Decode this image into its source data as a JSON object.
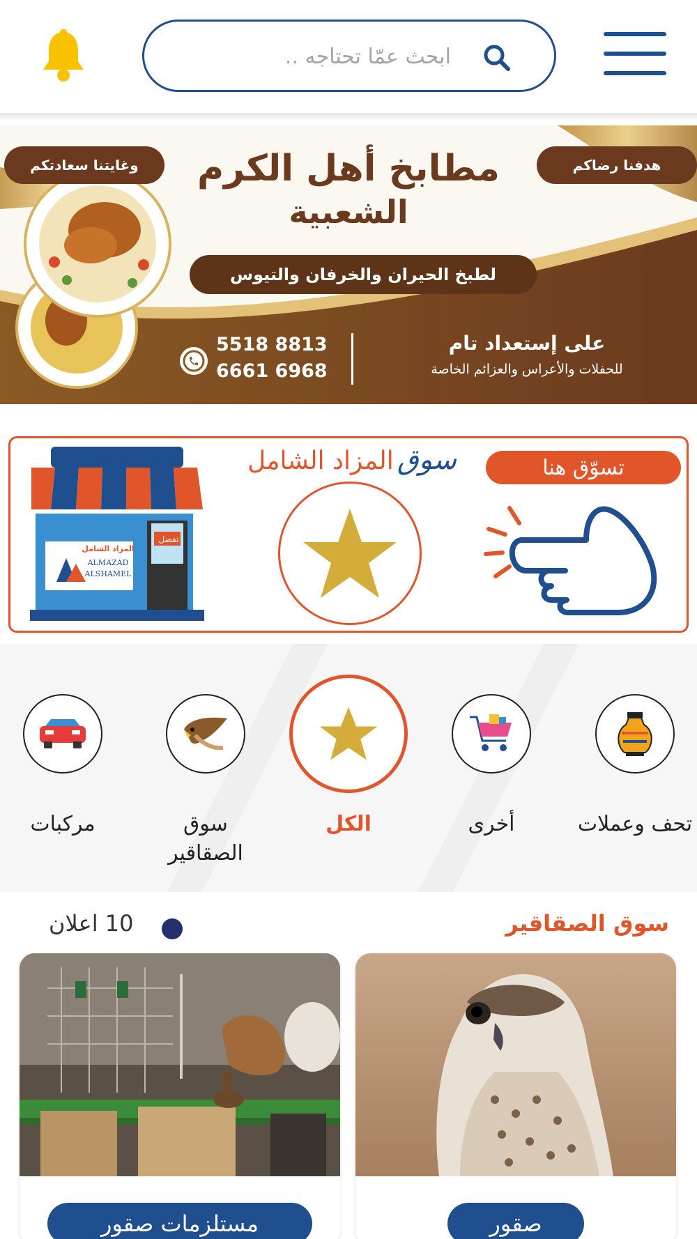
{
  "header": {
    "search_placeholder": "ابحث عمّا تحتاجه ..",
    "search_icon": "search-icon",
    "menu_icon": "hamburger-menu-icon",
    "bell_icon": "bell-icon"
  },
  "banner": {
    "tag_right": "هدفنا رضاكم",
    "tag_left": "وغايتنا سعادتكم",
    "title_line1": "مطابخ أهل الكرم",
    "title_line2": "الشعبية",
    "subtitle": "لطبخ الحيران والخرفان والتيوس",
    "ready_line1": "على إستعداد تام",
    "ready_line2": "للحفلات والأعراس والعزائم الخاصة",
    "phone1": "5518 8813",
    "phone2": "6661 6968"
  },
  "promo": {
    "title_blue": "سوق",
    "title_orange": "المزاد الشامل",
    "shop_here": "تسوّق هنا",
    "shop_sign": "تفضل",
    "shop_logo_ar": "المزاد الشامل",
    "shop_logo_en1": "ALMAZAD",
    "shop_logo_en2": "ALSHAMEL"
  },
  "categories": [
    {
      "label": "تحف وعملات",
      "icon": "vase-icon",
      "active": false
    },
    {
      "label": "أخرى",
      "icon": "shopping-cart-icon",
      "active": false
    },
    {
      "label": "الكل",
      "icon": "star-icon",
      "active": true
    },
    {
      "label": "سوق الصقاقير",
      "icon": "falcon-icon",
      "active": false
    },
    {
      "label": "مركبات",
      "icon": "car-icon",
      "active": false
    }
  ],
  "section": {
    "title": "سوق الصقاقير",
    "count": "10 اعلان"
  },
  "cards": [
    {
      "label": "صقور"
    },
    {
      "label": "مستلزمات صقور"
    }
  ],
  "colors": {
    "primary": "#1f4f8f",
    "accent": "#e0552a",
    "star": "#d4ac3a",
    "bell": "#f9c200",
    "banner_brown": "#6b3a1e"
  }
}
